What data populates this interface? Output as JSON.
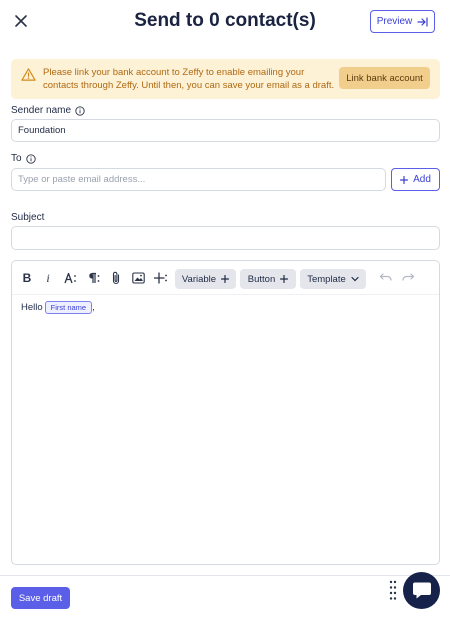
{
  "header": {
    "title": "Send to 0 contact(s)",
    "preview_label": "Preview"
  },
  "banner": {
    "message": "Please link your bank account to Zeffy to enable emailing your contacts through Zeffy. Until then, you can save your email as a draft.",
    "button_label": "Link bank account"
  },
  "form": {
    "sender_label": "Sender name",
    "sender_value": "Foundation",
    "to_label": "To",
    "to_placeholder": "Type or paste email address...",
    "add_label": "Add",
    "subject_label": "Subject",
    "subject_value": ""
  },
  "editor": {
    "toolbar": {
      "bold": "B",
      "italic": "i",
      "variable_label": "Variable",
      "button_label": "Button",
      "template_label": "Template"
    },
    "greeting": "Hello",
    "chip_label": "First name",
    "trailing": ","
  },
  "footer": {
    "save_label": "Save draft"
  },
  "colors": {
    "primary": "#5b5fe8",
    "warning_bg": "#fdf1d6",
    "warning_text": "#b06a12",
    "chat_bg": "#16224a"
  }
}
